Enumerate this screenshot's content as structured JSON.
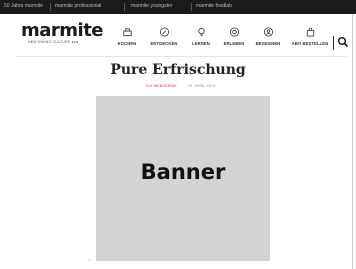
{
  "topbar": {
    "links": [
      "50 Jahre marmite",
      "marmite professional",
      "marmite youngster",
      "marmite foodlab"
    ]
  },
  "logo": {
    "wordmark": "marmite",
    "tagline": "NEW DINING CULTURE ●●●"
  },
  "nav": {
    "items": [
      {
        "label": "KOCHEN",
        "icon": "pot-icon"
      },
      {
        "label": "ENTDECKEN",
        "icon": "compass-icon"
      },
      {
        "label": "LERNEN",
        "icon": "lightbulb-icon"
      },
      {
        "label": "ERLEBEN",
        "icon": "camera-icon"
      },
      {
        "label": "BEGEGNEN",
        "icon": "people-icon"
      },
      {
        "label": "ABO BESTELLEN",
        "icon": "bag-icon"
      }
    ],
    "search_icon": "search-icon"
  },
  "article": {
    "title": "Pure Erfrischung",
    "category": "ICH WEBSDRINK",
    "date": "24. APRIL 2019"
  },
  "banner": {
    "label": "Banner"
  },
  "marker": "1",
  "colors": {
    "topbar_bg": "#1b1b1b",
    "category_red": "#c8373c",
    "banner_bg": "#d3d3d3"
  }
}
